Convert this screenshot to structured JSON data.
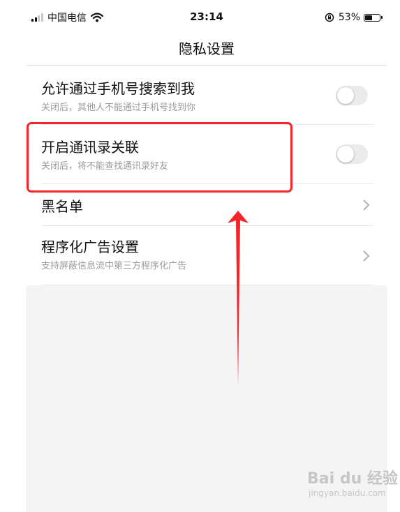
{
  "status_bar": {
    "carrier": "中国电信",
    "time": "23:14",
    "battery_percent": "53%",
    "battery_level": 0.53
  },
  "nav": {
    "title": "隐私设置"
  },
  "settings": [
    {
      "title": "允许通过手机号搜索到我",
      "subtitle": "关闭后，其他人不能通过手机号找到你",
      "control": "toggle",
      "enabled": false
    },
    {
      "title": "开启通讯录关联",
      "subtitle": "关闭后，将不能查找通讯录好友",
      "control": "toggle",
      "enabled": false
    },
    {
      "title": "黑名单",
      "control": "chevron"
    },
    {
      "title": "程序化广告设置",
      "subtitle": "支持屏蔽信息流中第三方程序化广告",
      "control": "chevron"
    }
  ],
  "annotation": {
    "highlight_color": "#f4242a",
    "arrow_color": "#f4242a"
  },
  "watermark": {
    "logo": "Bai du 经验",
    "url": "jingyan.baidu.com"
  },
  "icons": [
    "signal-icon",
    "wifi-icon",
    "rotation-lock-icon",
    "battery-icon",
    "chevron-right-icon"
  ]
}
